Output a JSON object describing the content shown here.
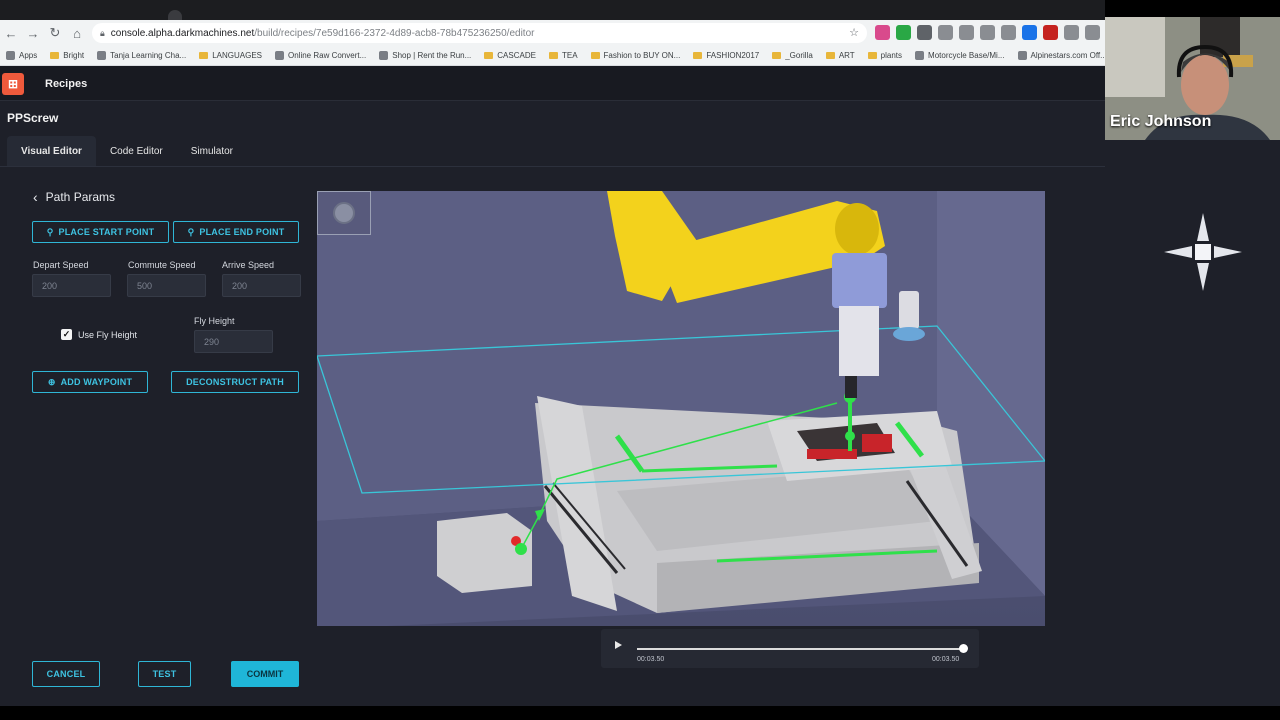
{
  "browser": {
    "url_host": "console.alpha.darkmachines.net",
    "url_path": "/build/recipes/7e59d166-2372-4d89-acb8-78b475236250/editor",
    "bookmarks": [
      "Apps",
      "Bright",
      "Tanja Learning Cha...",
      "LANGUAGES",
      "Online Raw Convert...",
      "Shop | Rent the Run...",
      "CASCADE",
      "TEA",
      "Fashion to BUY ON...",
      "FASHION2017",
      "_Gorilla",
      "ART",
      "plants",
      "Motorcycle Base/Mi...",
      "Alpinestars.com Off..."
    ]
  },
  "app": {
    "title": "Recipes",
    "logo_glyph": "⊞",
    "recipe_name": "PPScrew",
    "tabs": [
      {
        "label": "Visual Editor",
        "active": true
      },
      {
        "label": "Code Editor",
        "active": false
      },
      {
        "label": "Simulator",
        "active": false
      }
    ]
  },
  "panel": {
    "back_label": "Path Params",
    "place_start": "PLACE START POINT",
    "place_end": "PLACE END POINT",
    "depart_speed_label": "Depart Speed",
    "depart_speed_value": "200",
    "commute_speed_label": "Commute Speed",
    "commute_speed_value": "500",
    "arrive_speed_label": "Arrive Speed",
    "arrive_speed_value": "200",
    "use_fly_height_label": "Use Fly Height",
    "use_fly_height_checked": true,
    "fly_height_label": "Fly Height",
    "fly_height_value": "290",
    "add_waypoint": "ADD WAYPOINT",
    "deconstruct_path": "DECONSTRUCT PATH"
  },
  "footer": {
    "cancel": "CANCEL",
    "test": "TEST",
    "commit": "COMMIT"
  },
  "player": {
    "current_time": "00:03.50",
    "total_time": "00:03.50",
    "progress": 1.0
  },
  "webcam": {
    "name": "Eric Johnson"
  },
  "colors": {
    "accent": "#2fb6d6",
    "commit": "#1fb6d8",
    "path_green": "#2fe04a",
    "robot_yellow": "#f3d21c",
    "logo": "#ef5a3c"
  }
}
